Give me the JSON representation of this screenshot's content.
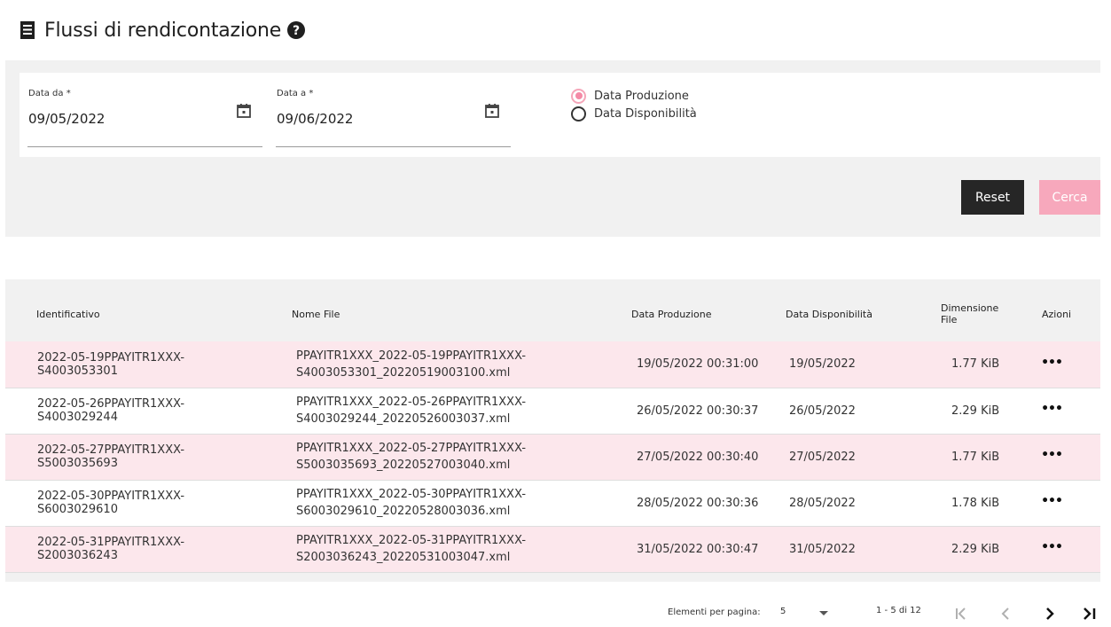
{
  "header": {
    "title": "Flussi di rendicontazione",
    "title_icon": "receipt-icon",
    "help_icon": "question-circle-icon"
  },
  "filters": {
    "date_from": {
      "label": "Data da *",
      "value": "09/05/2022",
      "icon": "calendar-icon"
    },
    "date_to": {
      "label": "Data a *",
      "value": "09/06/2022",
      "icon": "calendar-icon"
    },
    "radio_options": [
      {
        "label": "Data Produzione",
        "checked": true
      },
      {
        "label": "Data Disponibilità",
        "checked": false
      }
    ],
    "reset_label": "Reset",
    "search_label": "Cerca"
  },
  "table": {
    "columns": [
      "Identificativo",
      "Nome File",
      "Data Produzione",
      "Data Disponibilità",
      "Dimensione File",
      "Azioni"
    ],
    "rows": [
      {
        "id": "2022-05-19PPAYITR1XXX-S4003053301",
        "file_line1": "PPAYITR1XXX_2022-05-19PPAYITR1XXX-",
        "file_line2": "S4003053301_20220519003100.xml",
        "data_produzione": "19/05/2022 00:31:00",
        "data_disponibilita": "19/05/2022",
        "dimensione": "1.77 KiB"
      },
      {
        "id": "2022-05-26PPAYITR1XXX-S4003029244",
        "file_line1": "PPAYITR1XXX_2022-05-26PPAYITR1XXX-",
        "file_line2": "S4003029244_20220526003037.xml",
        "data_produzione": "26/05/2022 00:30:37",
        "data_disponibilita": "26/05/2022",
        "dimensione": "2.29 KiB"
      },
      {
        "id": "2022-05-27PPAYITR1XXX-S5003035693",
        "file_line1": "PPAYITR1XXX_2022-05-27PPAYITR1XXX-",
        "file_line2": "S5003035693_20220527003040.xml",
        "data_produzione": "27/05/2022 00:30:40",
        "data_disponibilita": "27/05/2022",
        "dimensione": "1.77 KiB"
      },
      {
        "id": "2022-05-30PPAYITR1XXX-S6003029610",
        "file_line1": "PPAYITR1XXX_2022-05-30PPAYITR1XXX-",
        "file_line2": "S6003029610_20220528003036.xml",
        "data_produzione": "28/05/2022 00:30:36",
        "data_disponibilita": "28/05/2022",
        "dimensione": "1.78 KiB"
      },
      {
        "id": "2022-05-31PPAYITR1XXX-S2003036243",
        "file_line1": "PPAYITR1XXX_2022-05-31PPAYITR1XXX-",
        "file_line2": "S2003036243_20220531003047.xml",
        "data_produzione": "31/05/2022 00:30:47",
        "data_disponibilita": "31/05/2022",
        "dimensione": "2.29 KiB"
      }
    ],
    "actions_icon": "more-horizontal-icon"
  },
  "paginator": {
    "items_per_page_label": "Elementi per pagina:",
    "page_size": "5",
    "range_label": "1 - 5 di 12",
    "icons": [
      "first-page-icon",
      "previous-page-icon",
      "next-page-icon",
      "last-page-icon"
    ]
  },
  "colors": {
    "accent": "#f7a8bc",
    "row_highlight": "#fce7ec",
    "panel_bg": "#f1f1f1",
    "dark_button": "#262626"
  }
}
